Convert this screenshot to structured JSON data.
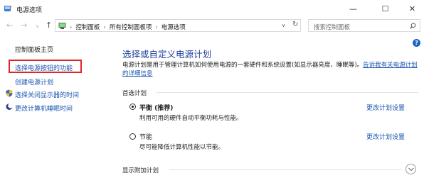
{
  "window": {
    "title": "电源选项",
    "minimize_glyph": "—",
    "maximize_glyph": "☐",
    "close_glyph": "✕"
  },
  "nav": {
    "back_glyph": "←",
    "forward_glyph": "→",
    "dropdown_glyph": "∨",
    "up_glyph": "↑",
    "breadcrumb": [
      "控制面板",
      "所有控制面板项",
      "电源选项"
    ],
    "separator": "›",
    "refresh_glyph": "↻",
    "search_placeholder": "搜索控制面板"
  },
  "help_glyph": "?",
  "sidebar": {
    "home": "控制面板主页",
    "items": [
      {
        "label": "选择电源按钮的功能",
        "icon": "none"
      },
      {
        "label": "创建电源计划",
        "icon": "none"
      },
      {
        "label": "选择关闭显示器的时间",
        "icon": "shield-icon"
      },
      {
        "label": "更改计算机睡眠时间",
        "icon": "moon-icon"
      }
    ]
  },
  "main": {
    "heading": "选择或自定义电源计划",
    "desc_text": "电源计划是用于管理计算机如何使用电源的一套硬件和系统设置(如显示器亮度、睡眠等)。",
    "desc_link": "告诉我有关电源计划的详细信息",
    "preferred_header": "首选计划",
    "plans": [
      {
        "name": "平衡 (推荐)",
        "desc": "利用可用的硬件自动平衡功耗与性能。",
        "selected": true,
        "change_label": "更改计划设置"
      },
      {
        "name": "节能",
        "desc": "尽可能降低计算机性能以节能。",
        "selected": false,
        "change_label": "更改计划设置"
      }
    ],
    "additional_header": "显示附加计划"
  },
  "colors": {
    "accent": "#1a56b0",
    "heading": "#1e3f9a",
    "highlight": "#e0262b"
  }
}
